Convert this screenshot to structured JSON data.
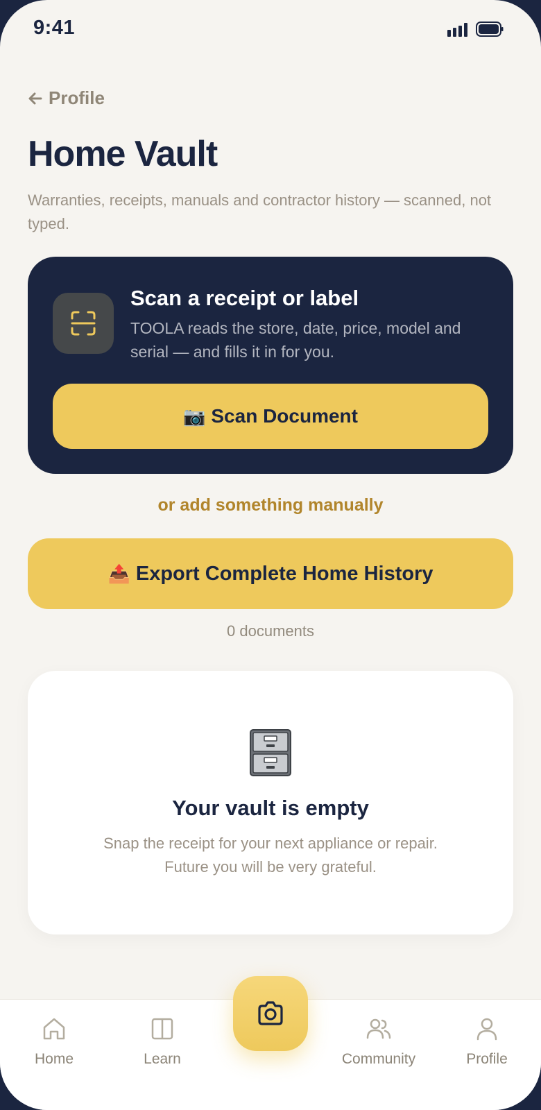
{
  "status_bar": {
    "time": "9:41"
  },
  "nav": {
    "back_label": "Profile"
  },
  "header": {
    "title": "Home Vault",
    "subtitle": "Warranties, receipts, manuals and contractor history — scanned, not typed."
  },
  "scan_card": {
    "title": "Scan a receipt or label",
    "description": "TOOLA reads the store, date, price, model and serial — and fills it in for you.",
    "button_emoji": "📷",
    "button_label": "Scan Document"
  },
  "manual_link": "or add something manually",
  "export": {
    "emoji": "📤",
    "label": "Export Complete Home History"
  },
  "document_count": "0 documents",
  "empty_state": {
    "icon": "file-cabinet-icon",
    "title": "Your vault is empty",
    "line1": "Snap the receipt for your next appliance or repair.",
    "line2": "Future you will be very grateful."
  },
  "tab_bar": {
    "items": [
      {
        "label": "Home",
        "icon": "home-icon"
      },
      {
        "label": "Learn",
        "icon": "book-icon"
      },
      {
        "label": "Community",
        "icon": "people-icon"
      },
      {
        "label": "Profile",
        "icon": "person-icon"
      }
    ],
    "fab_icon": "camera-icon"
  },
  "colors": {
    "navy": "#1b2540",
    "accent_yellow": "#eec95c",
    "background": "#f6f4f0",
    "link_gold": "#b1852b",
    "muted_text": "#9a9185"
  }
}
